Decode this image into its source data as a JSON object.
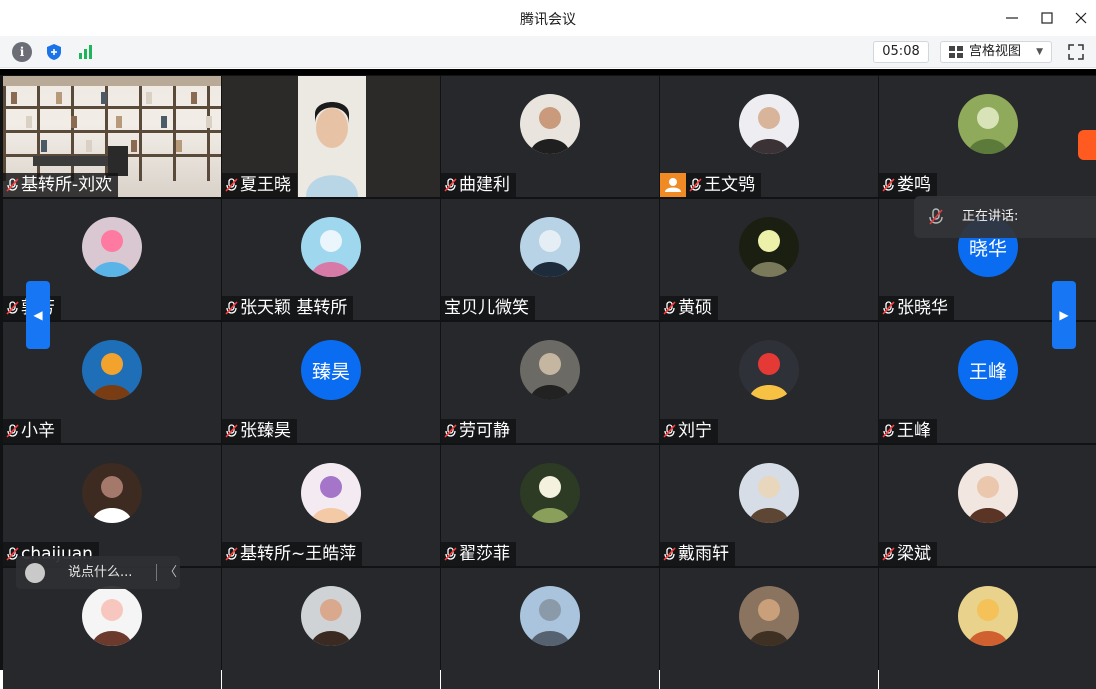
{
  "window": {
    "title": "腾讯会议"
  },
  "toolbar": {
    "timer": "05:08",
    "view_label": "宫格视图"
  },
  "speaking_label": "正在讲话:",
  "chat": {
    "placeholder": "说点什么...",
    "collapse": "〈"
  },
  "participants": [
    {
      "name": "基转所-刘欢",
      "mic": "muted",
      "av": "video-room"
    },
    {
      "name": "夏王晓",
      "mic": "muted",
      "av": "video-person"
    },
    {
      "name": "曲建利",
      "mic": "muted",
      "av": "photo-woman"
    },
    {
      "name": "王文鸮",
      "mic": "muted",
      "av": "photo-portrait",
      "host": true
    },
    {
      "name": "娄鸣",
      "mic": "muted",
      "av": "photo-green"
    },
    {
      "name": "郭芳",
      "mic": "muted",
      "av": "photo-child"
    },
    {
      "name": "张天颖 基转所",
      "mic": "muted",
      "av": "photo-sky"
    },
    {
      "name": "宝贝儿微笑",
      "mic": "none",
      "av": "photo-sea"
    },
    {
      "name": "黄硕",
      "mic": "muted",
      "av": "photo-moon"
    },
    {
      "name": "张晓华",
      "mic": "muted",
      "av": "text",
      "text": "晓华"
    },
    {
      "name": "小辛",
      "mic": "muted",
      "av": "photo-lion"
    },
    {
      "name": "张臻昊",
      "mic": "muted",
      "av": "text",
      "text": "臻昊"
    },
    {
      "name": "劳可静",
      "mic": "muted",
      "av": "photo-sunset"
    },
    {
      "name": "刘宁",
      "mic": "muted",
      "av": "photo-balloon"
    },
    {
      "name": "王峰",
      "mic": "muted",
      "av": "text",
      "text": "王峰"
    },
    {
      "name": "chaijuan",
      "mic": "muted",
      "av": "photo-phone"
    },
    {
      "name": "基转所~王皓萍",
      "mic": "muted",
      "av": "photo-cartoon-girl"
    },
    {
      "name": "翟莎菲",
      "mic": "muted",
      "av": "photo-flowers"
    },
    {
      "name": "戴雨轩",
      "mic": "muted",
      "av": "photo-hat"
    },
    {
      "name": "梁斌",
      "mic": "muted",
      "av": "photo-kid"
    },
    {
      "name": "",
      "mic": "none",
      "av": "photo-doll"
    },
    {
      "name": "",
      "mic": "none",
      "av": "photo-face"
    },
    {
      "name": "",
      "mic": "none",
      "av": "photo-road"
    },
    {
      "name": "",
      "mic": "none",
      "av": "photo-cat"
    },
    {
      "name": "",
      "mic": "none",
      "av": "photo-field"
    }
  ],
  "icons": {
    "info": "info-icon",
    "shield": "shield-icon",
    "signal": "signal-icon",
    "grid": "grid-view-icon",
    "fullscreen": "fullscreen-icon",
    "mic_muted": "mic-muted-icon"
  },
  "colors": {
    "accent": "#0a6cf0",
    "host": "#f08a24",
    "tile": "#26282c"
  }
}
